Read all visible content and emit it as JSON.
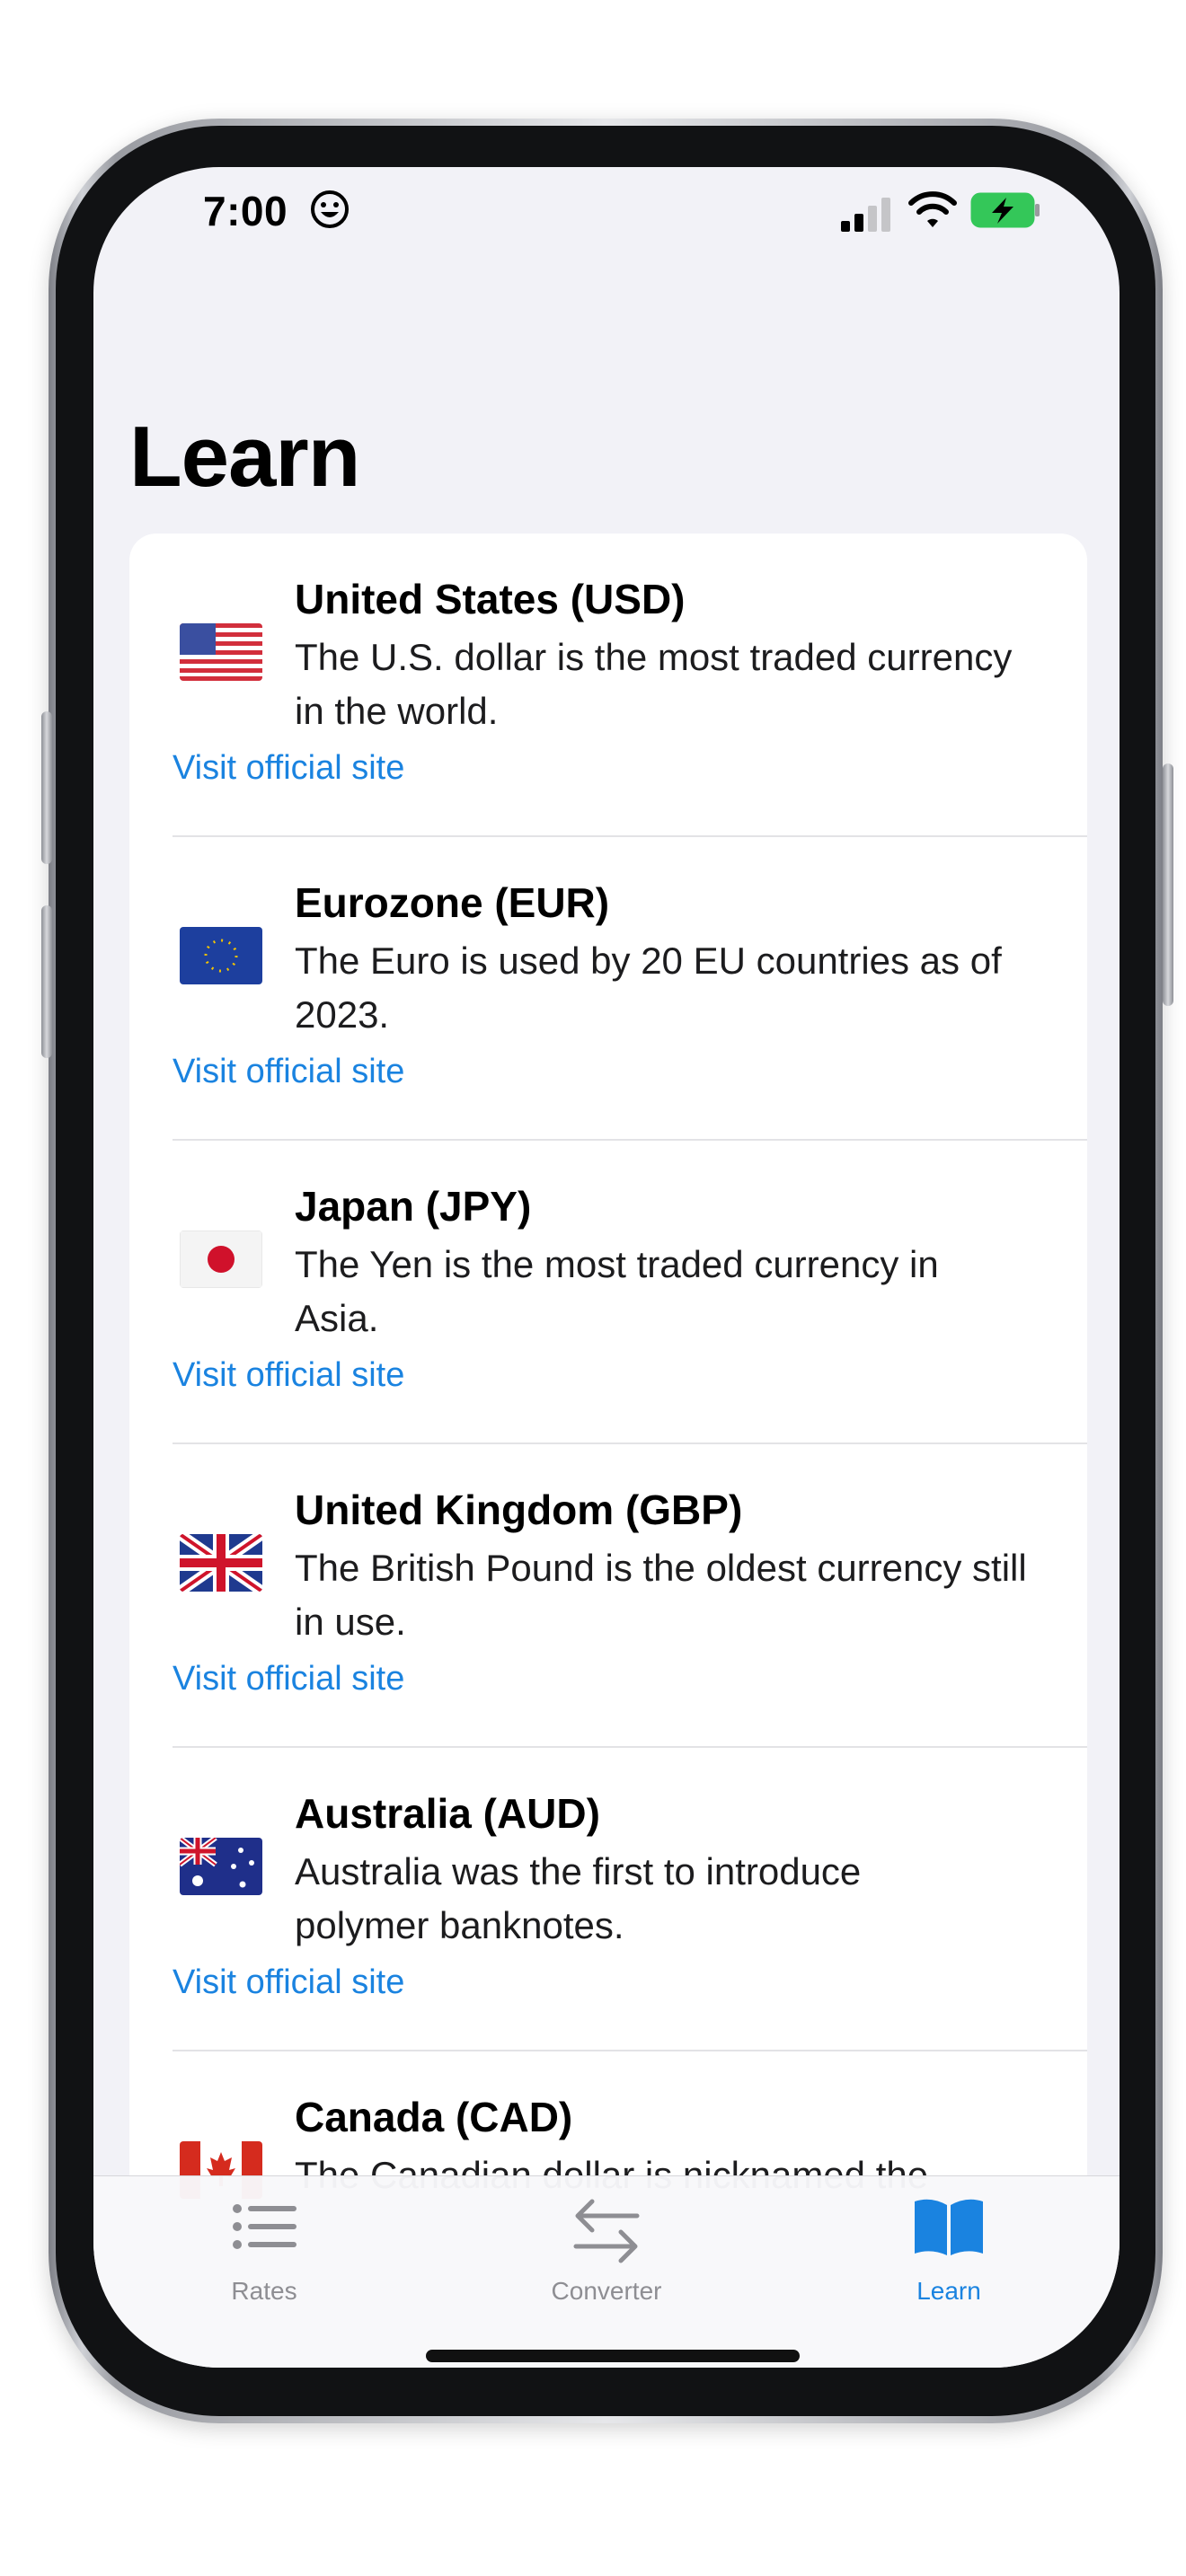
{
  "status_bar": {
    "time": "7:00",
    "icons": [
      "smiley-icon",
      "signal-icon",
      "wifi-icon",
      "battery-charging-icon"
    ]
  },
  "page": {
    "title": "Learn"
  },
  "currencies": [
    {
      "flag": "us-flag-icon",
      "title": "United States (USD)",
      "description": "The U.S. dollar is the most traded currency in the world.",
      "link": "Visit official site"
    },
    {
      "flag": "eu-flag-icon",
      "title": "Eurozone (EUR)",
      "description": "The Euro is used by 20 EU countries as of 2023.",
      "link": "Visit official site"
    },
    {
      "flag": "japan-flag-icon",
      "title": "Japan (JPY)",
      "description": "The Yen is the most traded currency in Asia.",
      "link": "Visit official site"
    },
    {
      "flag": "uk-flag-icon",
      "title": "United Kingdom (GBP)",
      "description": "The British Pound is the oldest currency still in use.",
      "link": "Visit official site"
    },
    {
      "flag": "australia-flag-icon",
      "title": "Australia (AUD)",
      "description": "Australia was the first to introduce polymer banknotes.",
      "link": "Visit official site"
    },
    {
      "flag": "canada-flag-icon",
      "title": "Canada (CAD)",
      "description": "The Canadian dollar is nicknamed the",
      "link": ""
    }
  ],
  "tab_bar": {
    "tabs": [
      {
        "label": "Rates",
        "icon": "list-icon",
        "active": false
      },
      {
        "label": "Converter",
        "icon": "arrows-swap-icon",
        "active": false
      },
      {
        "label": "Learn",
        "icon": "book-icon",
        "active": true
      }
    ]
  },
  "colors": {
    "accent": "#1a83e0",
    "background": "#f2f2f7",
    "inactive_tab": "#8e8e93"
  }
}
